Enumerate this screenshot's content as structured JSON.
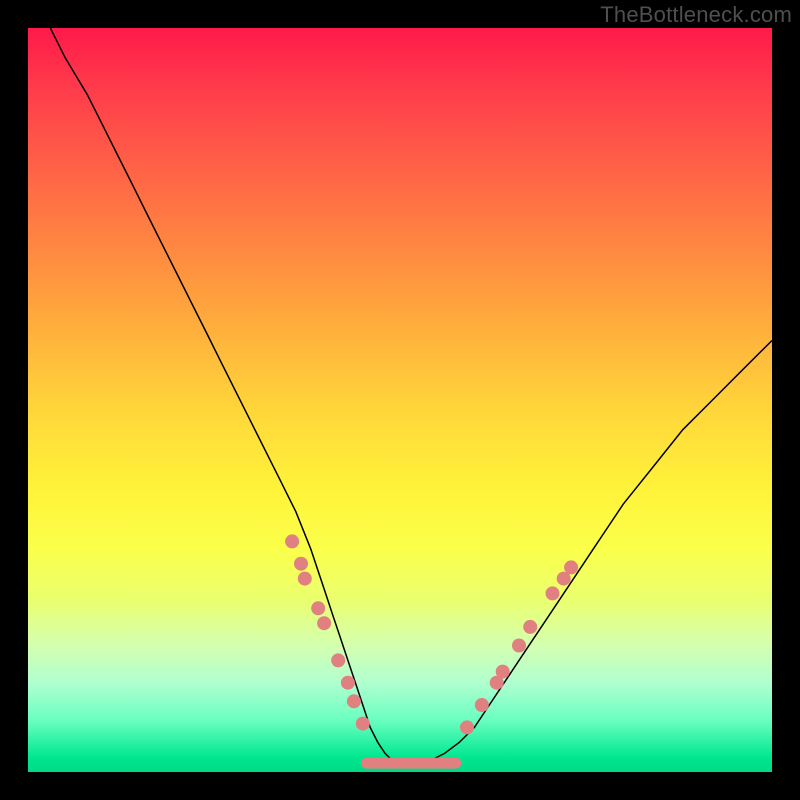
{
  "watermark": "TheBottleneck.com",
  "colors": {
    "dot": "#e08080",
    "curve": "#000000",
    "gradient_top": "#ff1a4a",
    "gradient_bottom": "#00d884"
  },
  "chart_data": {
    "type": "line",
    "title": "",
    "xlabel": "",
    "ylabel": "",
    "xlim": [
      0,
      100
    ],
    "ylim": [
      0,
      100
    ],
    "series": [
      {
        "name": "bottleneck-curve",
        "x": [
          3,
          5,
          8,
          10,
          12,
          14,
          16,
          18,
          20,
          22,
          24,
          26,
          28,
          30,
          32,
          34,
          36,
          38,
          40,
          41,
          42,
          43,
          44,
          45,
          46,
          47,
          48,
          49,
          50,
          52,
          54,
          56,
          58,
          60,
          62,
          64,
          66,
          68,
          70,
          72,
          74,
          76,
          78,
          80,
          84,
          88,
          92,
          96,
          100
        ],
        "y": [
          100,
          96,
          91,
          87,
          83,
          79,
          75,
          71,
          67,
          63,
          59,
          55,
          51,
          47,
          43,
          39,
          35,
          30,
          24,
          21,
          18,
          15,
          12,
          9,
          6,
          4,
          2.5,
          1.5,
          1,
          1,
          1.5,
          2.5,
          4,
          6,
          9,
          12,
          15,
          18,
          21,
          24,
          27,
          30,
          33,
          36,
          41,
          46,
          50,
          54,
          58
        ]
      }
    ],
    "points_left": [
      {
        "x": 35.5,
        "y": 31
      },
      {
        "x": 36.7,
        "y": 28
      },
      {
        "x": 37.2,
        "y": 26
      },
      {
        "x": 39.0,
        "y": 22
      },
      {
        "x": 39.8,
        "y": 20
      },
      {
        "x": 41.7,
        "y": 15
      },
      {
        "x": 43.0,
        "y": 12
      },
      {
        "x": 43.8,
        "y": 9.5
      },
      {
        "x": 45.0,
        "y": 6.5
      }
    ],
    "points_right": [
      {
        "x": 59.0,
        "y": 6
      },
      {
        "x": 61.0,
        "y": 9
      },
      {
        "x": 63.0,
        "y": 12
      },
      {
        "x": 63.8,
        "y": 13.5
      },
      {
        "x": 66.0,
        "y": 17
      },
      {
        "x": 67.5,
        "y": 19.5
      },
      {
        "x": 70.5,
        "y": 24
      },
      {
        "x": 72.0,
        "y": 26
      },
      {
        "x": 73.0,
        "y": 27.5
      }
    ],
    "flat_segment": {
      "x0": 45.5,
      "x1": 57.5,
      "y": 1.2
    }
  }
}
